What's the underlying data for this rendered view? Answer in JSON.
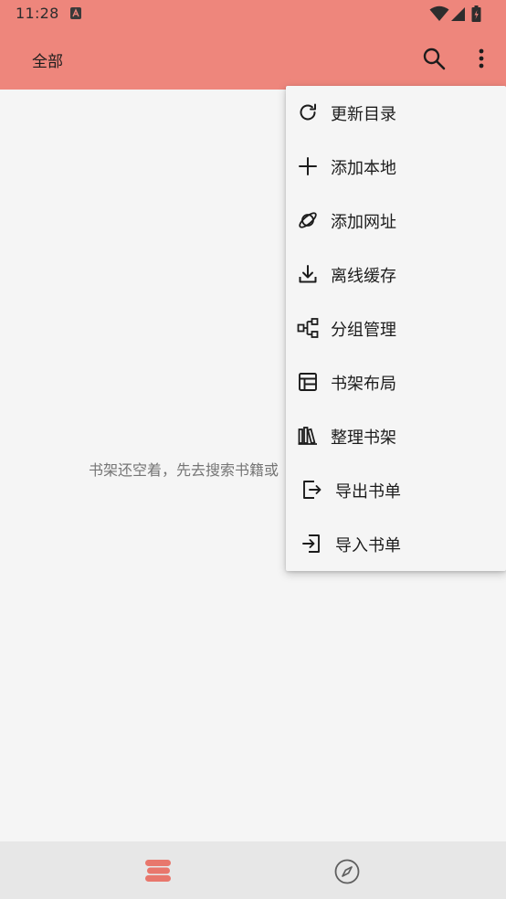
{
  "status_bar": {
    "time": "11:28"
  },
  "app_bar": {
    "title": "全部",
    "search_icon": "search-icon",
    "more_icon": "more-vert-icon"
  },
  "empty_state": {
    "text": "书架还空着，先去搜索书籍或"
  },
  "menu": {
    "items": [
      {
        "label": "更新目录",
        "icon": "refresh-icon"
      },
      {
        "label": "添加本地",
        "icon": "plus-icon"
      },
      {
        "label": "添加网址",
        "icon": "planet-icon"
      },
      {
        "label": "离线缓存",
        "icon": "download-icon"
      },
      {
        "label": "分组管理",
        "icon": "group-icon"
      },
      {
        "label": "书架布局",
        "icon": "layout-icon"
      },
      {
        "label": "整理书架",
        "icon": "books-icon"
      },
      {
        "label": "导出书单",
        "icon": "export-icon"
      },
      {
        "label": "导入书单",
        "icon": "import-icon"
      }
    ]
  },
  "bottom_nav": {
    "items": [
      {
        "icon": "bookshelf-icon",
        "active": true
      },
      {
        "icon": "compass-icon",
        "active": false
      }
    ]
  },
  "colors": {
    "accent": "#ee867c",
    "background": "#f5f5f5",
    "nav_bg": "#e7e7e7",
    "active_icon": "#e8776c"
  }
}
